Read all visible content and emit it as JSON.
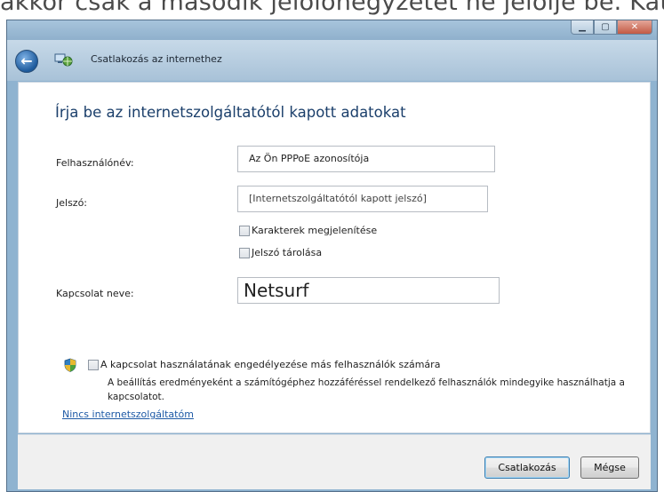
{
  "background_caption": "akkor csak a második jelölőnégyzetet ne jelölje be. Kat",
  "window": {
    "controls": {
      "minimize": "▁",
      "maximize": "▢",
      "close": "✕"
    },
    "nav": {
      "back_icon": "back-arrow-icon",
      "title": "Csatlakozás az internethez"
    }
  },
  "form": {
    "heading": "Írja be az internetszolgáltatótól kapott adatokat",
    "username": {
      "label": "Felhasználónév:",
      "value": "Az Ön PPPoE azonosítója"
    },
    "password": {
      "label": "Jelszó:",
      "value": "[Internetszolgáltatótól kapott jelszó]"
    },
    "show_chars": {
      "label": "Karakterek megjelenítése",
      "checked": false
    },
    "remember_password": {
      "label": "Jelszó tárolása",
      "checked": false
    },
    "connection_name": {
      "label": "Kapcsolat neve:",
      "value": "Netsurf"
    },
    "allow_others": {
      "label": "A kapcsolat használatának engedélyezése más felhasználók számára",
      "checked": false,
      "icon": "shield-icon",
      "description": "A beállítás eredményeként a számítógéphez hozzáféréssel rendelkező felhasználók mindegyike használhatja a kapcsolatot."
    },
    "no_isp_link": "Nincs internetszolgáltatóm"
  },
  "buttons": {
    "connect": "Csatlakozás",
    "cancel": "Mégse"
  },
  "colors": {
    "heading": "#1b3f6b",
    "link": "#1e5aa6",
    "frame": "#8fb3d0"
  }
}
